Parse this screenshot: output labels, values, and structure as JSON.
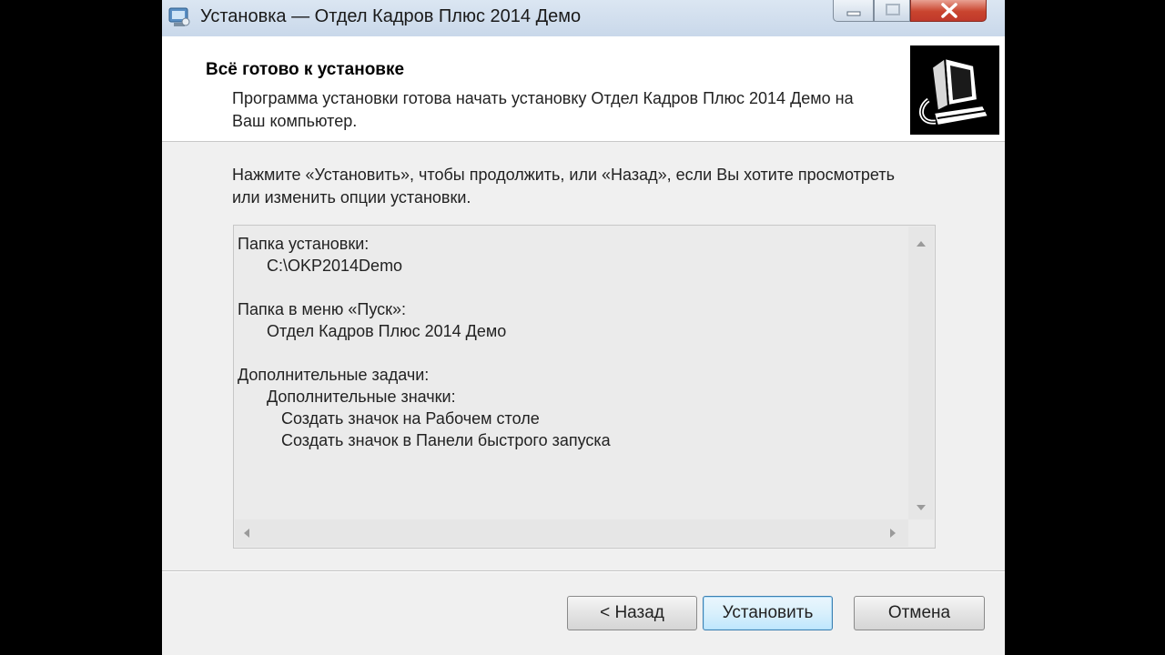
{
  "window": {
    "title": "Установка — Отдел Кадров Плюс 2014 Демо",
    "icon": "installer-icon",
    "controls": [
      "minimize-icon",
      "maximize-icon",
      "close-icon"
    ]
  },
  "header": {
    "title": "Всё готово к установке",
    "subtitle": "Программа установки готова начать установку Отдел Кадров Плюс 2014 Демо на Ваш компьютер.",
    "image": "installer-wizard-image"
  },
  "instructions": "Нажмите «Установить», чтобы продолжить, или «Назад», если Вы хотите просмотреть или изменить опции установки.",
  "summary": {
    "install_folder_label": "Папка установки:",
    "install_folder_value": "C:\\OKP2014Demo",
    "start_menu_label": "Папка в меню «Пуск»:",
    "start_menu_value": "Отдел Кадров Плюс 2014 Демо",
    "tasks_label": "Дополнительные задачи:",
    "icons_label": "Дополнительные значки:",
    "task_desktop": "Создать значок на Рабочем столе",
    "task_quicklaunch": "Создать значок в Панели быстрого запуска"
  },
  "buttons": {
    "back": "< Назад",
    "install": "Установить",
    "cancel": "Отмена"
  }
}
